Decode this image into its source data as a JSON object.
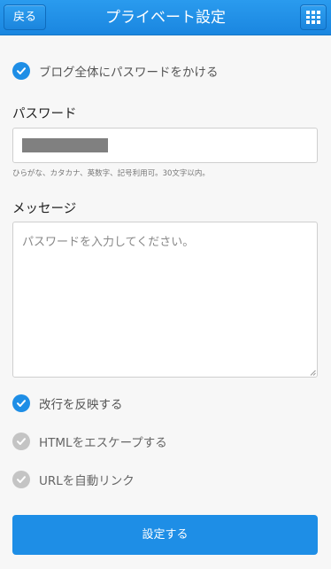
{
  "header": {
    "back_label": "戻る",
    "title": "プライベート設定",
    "menu_icon": "grid-icon"
  },
  "form": {
    "protect_all": {
      "label": "ブログ全体にパスワードをかける",
      "checked": true
    },
    "password": {
      "label": "パスワード",
      "value": "",
      "hint": "ひらがな、カタカナ、英数字、記号利用可。30文字以内。"
    },
    "message": {
      "label": "メッセージ",
      "placeholder": "パスワードを入力してください。"
    },
    "options": [
      {
        "label": "改行を反映する",
        "checked": true
      },
      {
        "label": "HTMLをエスケープする",
        "checked": false
      },
      {
        "label": "URLを自動リンク",
        "checked": false
      }
    ],
    "submit_label": "設定する"
  },
  "colors": {
    "accent": "#1e8ee6",
    "unchecked": "#c4c4c4",
    "background": "#f7f7f7"
  }
}
